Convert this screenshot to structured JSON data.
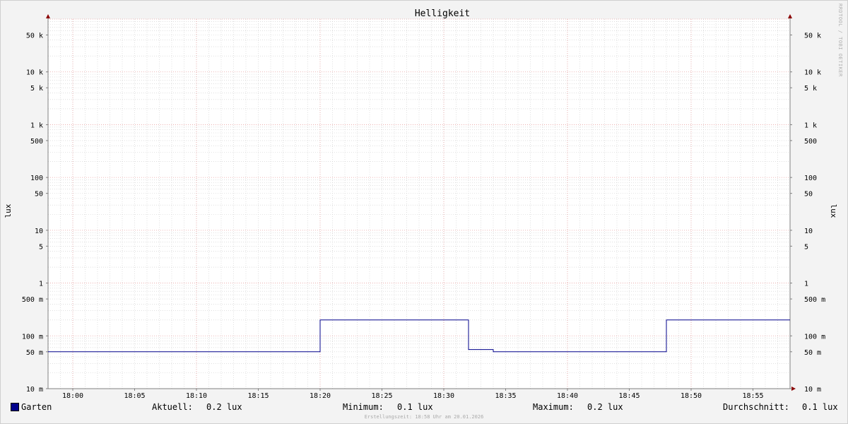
{
  "chart_data": {
    "type": "line",
    "title": "Helligkeit",
    "ylabel_left": "lux",
    "ylabel_right": "lux",
    "yscale": "log",
    "ylim": [
      0.01,
      100000
    ],
    "yticks": [
      {
        "value": 0.01,
        "label": "10 m"
      },
      {
        "value": 0.05,
        "label": "50 m"
      },
      {
        "value": 0.1,
        "label": "100 m"
      },
      {
        "value": 0.5,
        "label": "500 m"
      },
      {
        "value": 1,
        "label": "1"
      },
      {
        "value": 5,
        "label": "5"
      },
      {
        "value": 10,
        "label": "10"
      },
      {
        "value": 50,
        "label": "50"
      },
      {
        "value": 100,
        "label": "100"
      },
      {
        "value": 500,
        "label": "500"
      },
      {
        "value": 1000,
        "label": "1 k"
      },
      {
        "value": 5000,
        "label": "5 k"
      },
      {
        "value": 10000,
        "label": "10 k"
      },
      {
        "value": 50000,
        "label": "50 k"
      }
    ],
    "xlim": [
      "17:58",
      "18:58"
    ],
    "xticks": [
      "18:00",
      "18:05",
      "18:10",
      "18:15",
      "18:20",
      "18:25",
      "18:30",
      "18:35",
      "18:40",
      "18:45",
      "18:50",
      "18:55"
    ],
    "grid": true,
    "series": [
      {
        "name": "Garten",
        "color": "#00008b",
        "step": true,
        "points": [
          {
            "x": "17:58",
            "y": 0.05
          },
          {
            "x": "18:20",
            "y": 0.2
          },
          {
            "x": "18:32",
            "y": 0.055
          },
          {
            "x": "18:34",
            "y": 0.05
          },
          {
            "x": "18:48",
            "y": 0.2
          },
          {
            "x": "18:58",
            "y": 0.2
          }
        ]
      }
    ]
  },
  "legend": {
    "series_name": "Garten",
    "swatch_color": "#00008b",
    "current_label": "Aktuell:",
    "current_value": "0.2 lux",
    "min_label": "Minimum:",
    "min_value": "0.1 lux",
    "max_label": "Maximum:",
    "max_value": "0.2 lux",
    "avg_label": "Durchschnitt:",
    "avg_value": "0.1 lux"
  },
  "side_credit": "RRDTOOL / TOBI OETIKER",
  "footer_note": "Erstellungszeit: 18:58 Uhr am 20.01.2026",
  "colors": {
    "background": "#f3f3f3",
    "plot_background": "#ffffff",
    "major_grid": "#e8a0a0",
    "minor_grid": "#cccccc",
    "axis": "#808080",
    "arrow": "#8b0000"
  }
}
